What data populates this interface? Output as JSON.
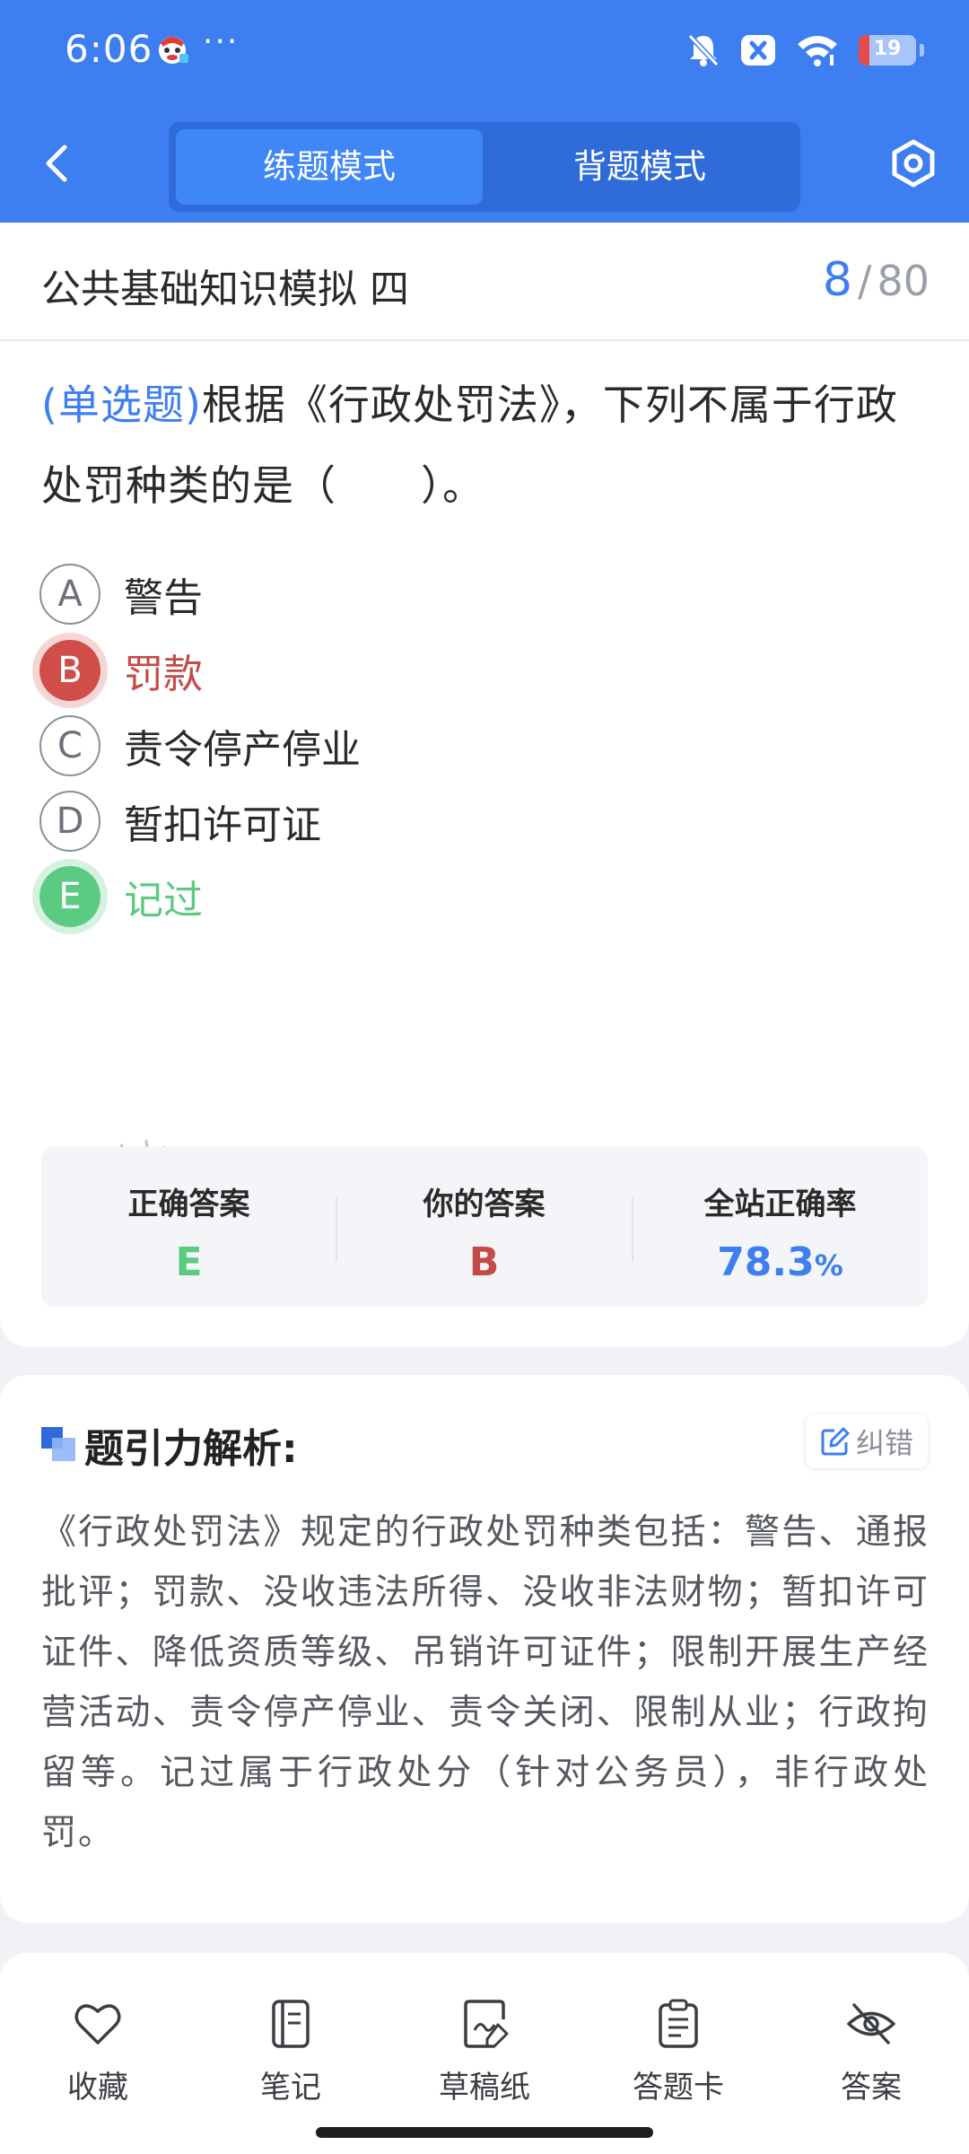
{
  "status_bar": {
    "time": "6:06",
    "more": "···",
    "battery": "19",
    "battery_level": 0.19
  },
  "header": {
    "tabs": [
      {
        "label": "练题模式",
        "active": true
      },
      {
        "label": "背题模式",
        "active": false
      }
    ]
  },
  "exam": {
    "title": "公共基础知识模拟 四",
    "current": "8",
    "separator": "/",
    "total": "80"
  },
  "question": {
    "type": "(单选题)",
    "text": "根据《行政处罚法》，下列不属于行政处罚种类的是（　　）。",
    "options": [
      {
        "letter": "A",
        "text": "警告",
        "state": "normal"
      },
      {
        "letter": "B",
        "text": "罚款",
        "state": "wrong"
      },
      {
        "letter": "C",
        "text": "责令停产停业",
        "state": "normal"
      },
      {
        "letter": "D",
        "text": "暂扣许可证",
        "state": "normal"
      },
      {
        "letter": "E",
        "text": "记过",
        "state": "correct"
      }
    ]
  },
  "watermark": "题引力",
  "result": {
    "correct_label": "正确答案",
    "correct_value": "E",
    "yours_label": "你的答案",
    "yours_value": "B",
    "rate_label": "全站正确率",
    "rate_value": "78.3",
    "rate_unit": "%"
  },
  "analysis": {
    "title": "题引力解析:",
    "report_label": "纠错",
    "text": "《行政处罚法》规定的行政处罚种类包括：警告、通报批评；罚款、没收违法所得、没收非法财物；暂扣许可证件、降低资质等级、吊销许可证件；限制开展生产经营活动、责令停产停业、责令关闭、限制从业；行政拘留等。记过属于行政处分（针对公务员），非行政处罚。"
  },
  "bottom_nav": [
    {
      "label": "收藏",
      "icon": "heart-icon"
    },
    {
      "label": "笔记",
      "icon": "notebook-icon"
    },
    {
      "label": "草稿纸",
      "icon": "draft-paper-icon"
    },
    {
      "label": "答题卡",
      "icon": "answer-sheet-icon"
    },
    {
      "label": "答案",
      "icon": "eye-off-icon"
    }
  ],
  "colors": {
    "primary": "#3d7ef0",
    "wrong": "#d04d4a",
    "correct": "#5ccb82"
  }
}
